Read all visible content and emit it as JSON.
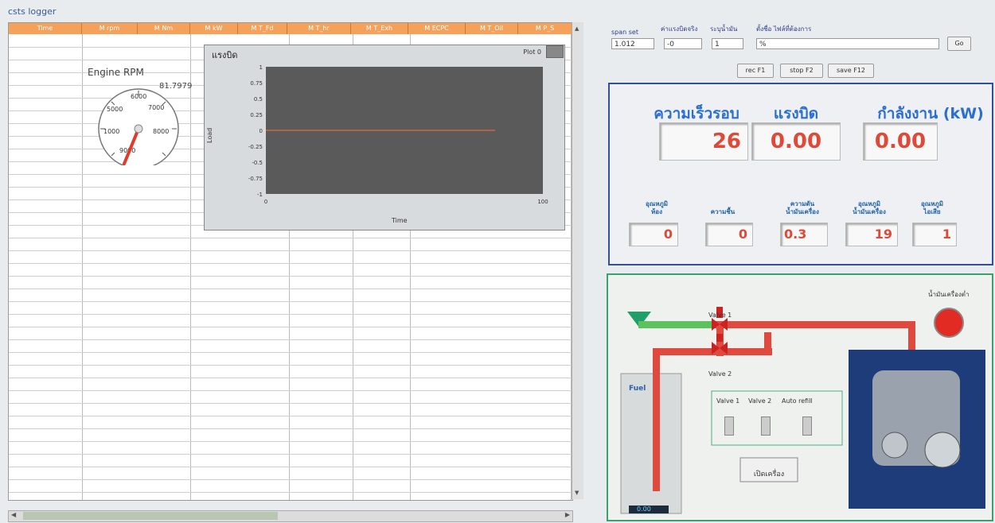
{
  "logger": {
    "title": "csts logger",
    "columns": [
      "Time",
      "M rpm",
      "M Nm",
      "M kW",
      "M T_Fd",
      "M T_hr",
      "M T_Exh",
      "M ECPC",
      "M T_Oil",
      "M P_S"
    ]
  },
  "gauge": {
    "label": "Engine RPM",
    "value": "81.7979",
    "ticks": [
      "6000",
      "7000",
      "5000",
      "8000",
      "1000",
      "9000"
    ]
  },
  "chart": {
    "title": "แรงบิด",
    "legend": "Plot 0",
    "ylabel": "Load",
    "xlabel": "Time",
    "y_ticks": [
      "1",
      "0.75",
      "0.5",
      "0.25",
      "0",
      "-0.25",
      "-0.5",
      "-0.75",
      "-1"
    ],
    "x_ticks": [
      "0",
      "100"
    ]
  },
  "chart_data": {
    "type": "line",
    "x": [
      0,
      100
    ],
    "series": [
      {
        "values": [
          0,
          0
        ]
      }
    ],
    "ylim": [
      -1,
      1
    ],
    "xlim": [
      0,
      100
    ],
    "xlabel": "Time",
    "ylabel": "Load",
    "title": "แรงบิด"
  },
  "settings": {
    "span_label": "span set",
    "span_value": "1.012",
    "field2_label": "ค่าแรงบิดจริง",
    "field2_value": "-0",
    "field3_label": "ระบุน้ำมัน",
    "field3_value": "1",
    "path_label": "ตั้งชื่อ ไฟล์ที่ต้องการ",
    "path_value": "%",
    "browse_label": "Go"
  },
  "fn_buttons": {
    "b1": "rec F1",
    "b2": "stop F2",
    "b3": "save F12"
  },
  "metrics": {
    "speed_label": "ความเร็วรอบ",
    "torque_label": "แรงบิด",
    "power_label": "กำลังงาน (kW)",
    "speed_value": "26",
    "torque_value": "0.00",
    "power_value": "0.00"
  },
  "temps": {
    "t1_label": "อุณหภูมิ\nห้อง",
    "t1_value": "0",
    "t2_label": "ความชื้น",
    "t2_value": "0",
    "t3_label": "ความดัน\nน้ำมันเครื่อง",
    "t3_value": "0.3",
    "t4_label": "อุณหภูมิ\nน้ำมันเครื่อง",
    "t4_value": "19",
    "t5_label": "อุณหภูมิ\nไอเสีย",
    "t5_value": "1"
  },
  "process": {
    "valve1": "Valve 1",
    "valve2": "Valve 2",
    "fuel": "Fuel",
    "fuel_reading": "0.00",
    "alarm_label": "น้ำมันเครื่องต่ำ",
    "switch1": "Valve 1",
    "switch2": "Valve 2",
    "switch3": "Auto refill",
    "start_button": "เปิดเครื่อง"
  },
  "colors": {
    "header": "#f6a15a",
    "accent_blue": "#2a6fd0",
    "value_red": "#e04838",
    "pipe_red": "#e04a3e",
    "pipe_green": "#5cc25c"
  }
}
